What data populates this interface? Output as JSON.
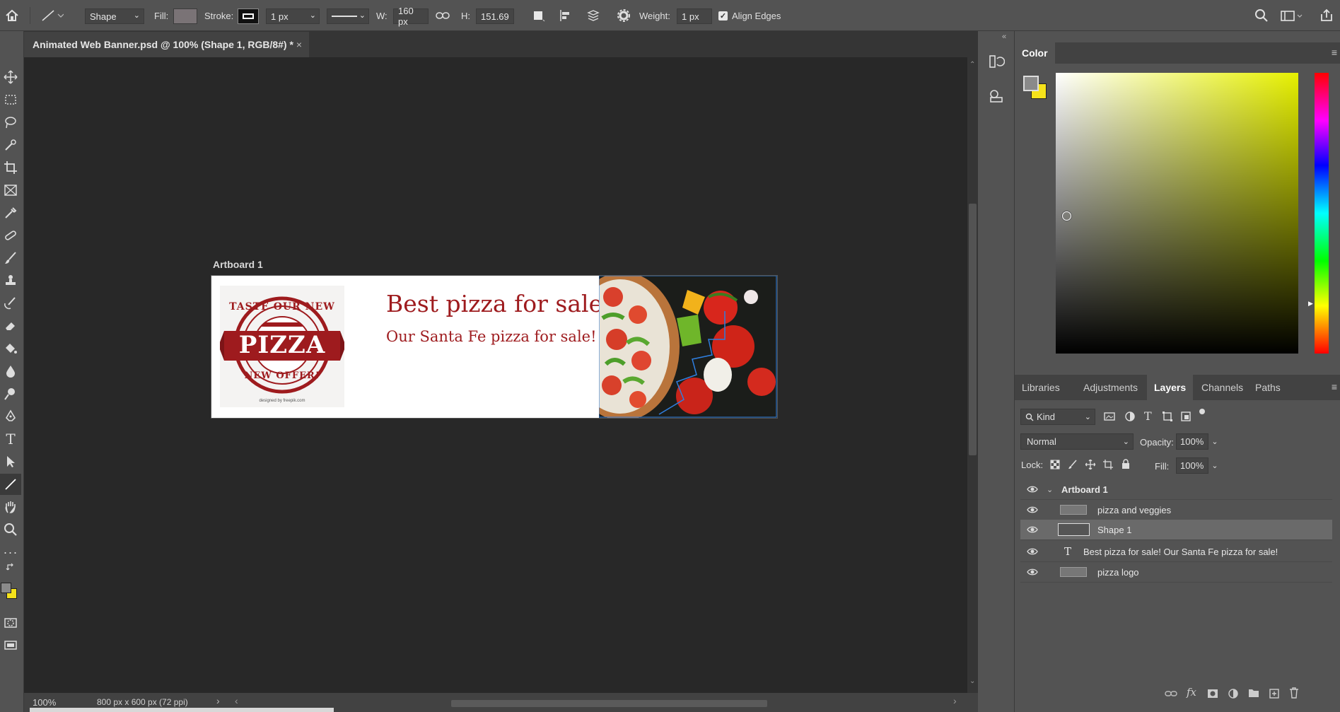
{
  "options_bar": {
    "shape_mode": "Shape",
    "fill_label": "Fill:",
    "stroke_label": "Stroke:",
    "stroke_width": "1 px",
    "w_label": "W:",
    "w_value": "160 px",
    "h_label": "H:",
    "h_value": "151.69",
    "weight_label": "Weight:",
    "weight_value": "1 px",
    "align_edges_label": "Align Edges",
    "align_edges_checked": true
  },
  "document": {
    "tab_title": "Animated Web Banner.psd @ 100% (Shape 1, RGB/8#) *",
    "artboard_label": "Artboard 1"
  },
  "banner": {
    "headline": "Best pizza for sale!",
    "subline": "Our Santa Fe pizza for sale!",
    "logo_top": "TASTE OUR NEW",
    "logo_main": "PIZZA",
    "logo_bottom": "NEW OFFER!",
    "logo_credit": "designed by freepik.com"
  },
  "status": {
    "zoom": "100%",
    "doc_size": "800 px x 600 px (72 ppi)"
  },
  "color_panel": {
    "tab_label": "Color",
    "foreground_color": "#8a8a8a",
    "background_color": "#f5e21b"
  },
  "layers_panel": {
    "tabs": [
      "Libraries",
      "Adjustments",
      "Layers",
      "Channels",
      "Paths"
    ],
    "active_tab": "Layers",
    "filter_kind": "Kind",
    "blend_mode": "Normal",
    "opacity_label": "Opacity:",
    "opacity_value": "100%",
    "lock_label": "Lock:",
    "fill_label": "Fill:",
    "fill_value": "100%",
    "layers": [
      {
        "name": "Artboard 1",
        "type": "artboard"
      },
      {
        "name": "pizza and veggies",
        "type": "smart"
      },
      {
        "name": "Shape 1",
        "type": "shape",
        "selected": true
      },
      {
        "name": "Best pizza for sale! Our Santa Fe pizza for sale!",
        "type": "text"
      },
      {
        "name": "pizza logo",
        "type": "smart"
      }
    ]
  },
  "colors": {
    "accent_red": "#9e1b1e",
    "selection_blue": "#2f7fe0"
  }
}
